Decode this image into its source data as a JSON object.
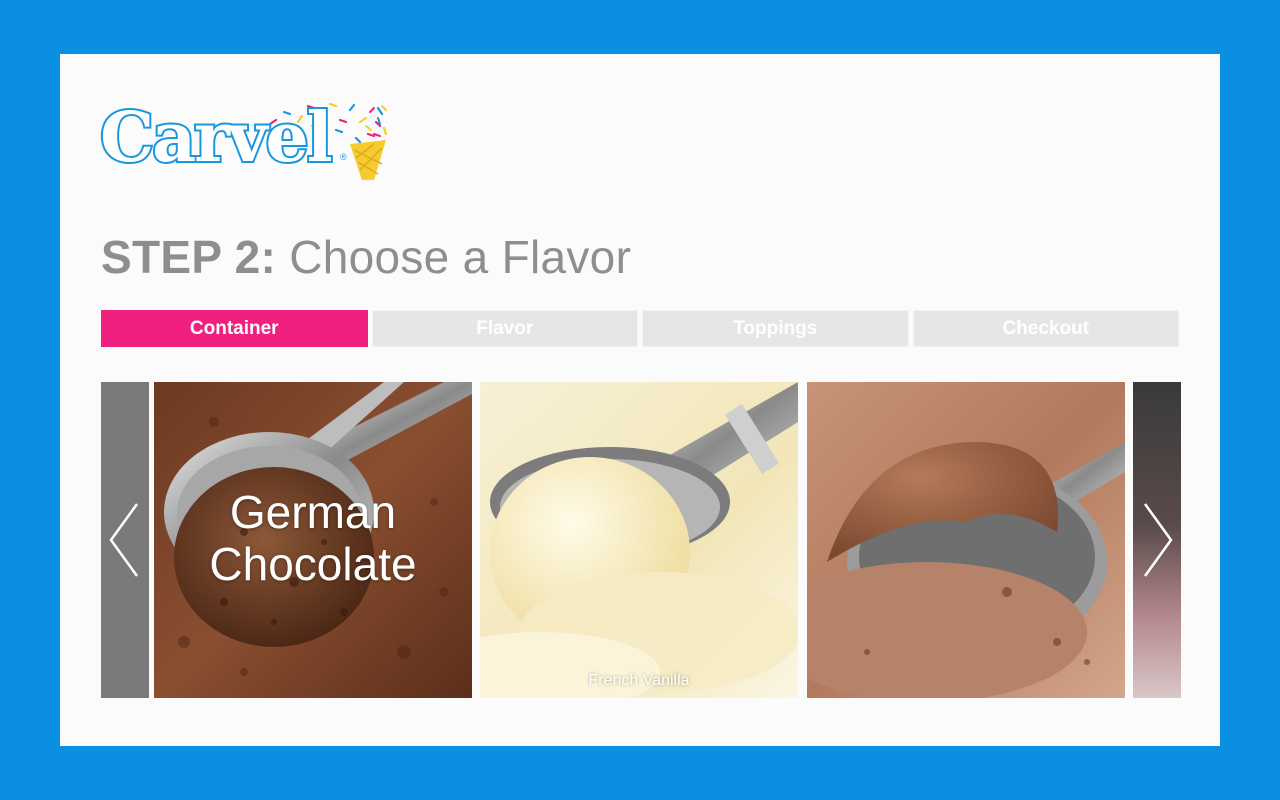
{
  "brand": {
    "name": "Carvel",
    "registered_mark": "®",
    "logo_color": "#1797df",
    "cone_color": "#f5cc2f"
  },
  "page": {
    "title_step": "STEP 2:",
    "title_text": " Choose a Flavor"
  },
  "progress": {
    "steps": [
      {
        "label": "Container",
        "active": true
      },
      {
        "label": "Flavor",
        "active": false
      },
      {
        "label": "Toppings",
        "active": false
      },
      {
        "label": "Checkout",
        "active": false
      }
    ],
    "active_color": "#f0207f",
    "inactive_color": "#e6e6e8"
  },
  "carousel": {
    "prev_icon": "chevron-left-icon",
    "next_icon": "chevron-right-icon",
    "flavors": [
      {
        "label": "German Chocolate",
        "label_line1": "German",
        "label_line2": "Chocolate"
      },
      {
        "label": "French Vanilla"
      },
      {
        "label": ""
      }
    ]
  },
  "colors": {
    "frame": "#0a8fe3",
    "card": "#fbfbfb",
    "title": "#8d8e90"
  }
}
